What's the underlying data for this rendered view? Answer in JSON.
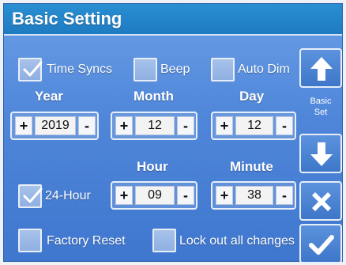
{
  "title": "Basic Setting",
  "toggles": {
    "time_syncs": {
      "label": "Time Syncs",
      "checked": true
    },
    "beep": {
      "label": "Beep",
      "checked": false
    },
    "auto_dim": {
      "label": "Auto Dim",
      "checked": false
    }
  },
  "date": {
    "year": {
      "label": "Year",
      "value": "2019"
    },
    "month": {
      "label": "Month",
      "value": "12"
    },
    "day": {
      "label": "Day",
      "value": "12"
    }
  },
  "time": {
    "hour": {
      "label": "Hour",
      "value": "09"
    },
    "minute": {
      "label": "Minute",
      "value": "38"
    }
  },
  "hour24": {
    "label": "24-Hour",
    "checked": true
  },
  "bottom": {
    "factory_reset": {
      "label": "Factory Reset",
      "checked": false
    },
    "lock_out": {
      "label": "Lock out all changes",
      "checked": false
    }
  },
  "side": {
    "up_icon": "arrow-up-icon",
    "label_line1": "Basic",
    "label_line2": "Set",
    "down_icon": "arrow-down-icon",
    "cancel_icon": "x-icon",
    "confirm_icon": "check-icon"
  },
  "controls": {
    "plus": "+",
    "minus": "-"
  }
}
